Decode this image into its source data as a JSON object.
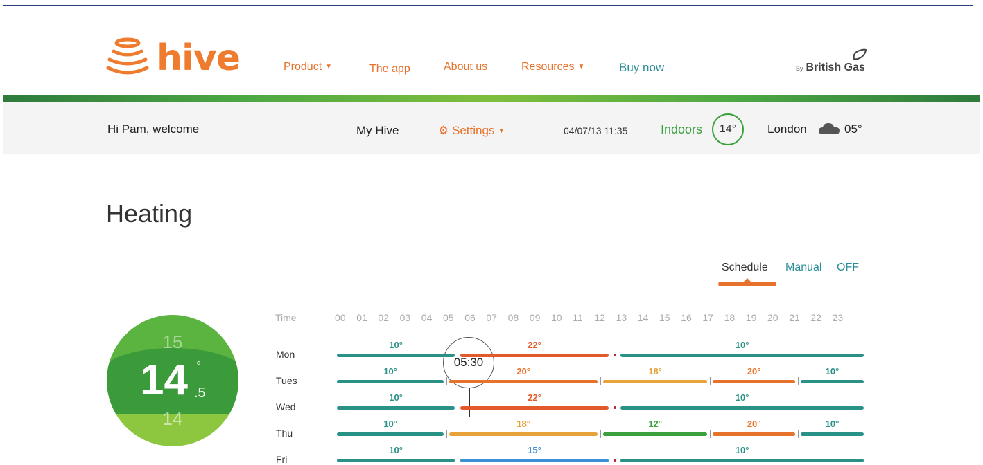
{
  "header": {
    "logo_text": "hive",
    "nav": [
      {
        "label": "Product",
        "dropdown": true
      },
      {
        "label": "The app",
        "dropdown": false
      },
      {
        "label": "About us",
        "dropdown": false
      },
      {
        "label": "Resources",
        "dropdown": true
      },
      {
        "label": "Buy now",
        "dropdown": false
      }
    ],
    "brand_by": "By",
    "brand_name": "British Gas"
  },
  "subbar": {
    "welcome": "Hi Pam, welcome",
    "my_hive": "My Hive",
    "settings": "Settings",
    "datetime": "04/07/13 11:35",
    "indoors_label": "Indoors",
    "indoors_temp": "14°",
    "city": "London",
    "outdoor_temp": "05°",
    "weather_icon": "cloud-icon"
  },
  "page": {
    "title": "Heating"
  },
  "mode_tabs": {
    "items": [
      "Schedule",
      "Manual",
      "OFF"
    ],
    "active": "Schedule"
  },
  "dial": {
    "upper": "15",
    "main": "14",
    "decimal": ".5",
    "degree": "°",
    "lower": "14"
  },
  "schedule": {
    "time_label": "Time",
    "hours": [
      "00",
      "01",
      "02",
      "03",
      "04",
      "05",
      "06",
      "07",
      "08",
      "09",
      "10",
      "11",
      "12",
      "13",
      "14",
      "15",
      "16",
      "17",
      "18",
      "19",
      "20",
      "21",
      "22",
      "23"
    ],
    "current_time_pin": "05:30",
    "days": [
      {
        "day": "Mon",
        "segments": [
          {
            "start": 0,
            "end": 5.5,
            "temp": "10°"
          },
          {
            "start": 5.5,
            "end": 12.5,
            "temp": "22°"
          },
          {
            "start": 12.8,
            "end": 24,
            "temp": "10°"
          }
        ]
      },
      {
        "day": "Tues",
        "segments": [
          {
            "start": 0,
            "end": 5,
            "temp": "10°"
          },
          {
            "start": 5,
            "end": 12,
            "temp": "20°"
          },
          {
            "start": 12,
            "end": 17,
            "temp": "18°"
          },
          {
            "start": 17,
            "end": 21,
            "temp": "20°"
          },
          {
            "start": 21,
            "end": 24,
            "temp": "10°"
          }
        ]
      },
      {
        "day": "Wed",
        "segments": [
          {
            "start": 0,
            "end": 5.5,
            "temp": "10°"
          },
          {
            "start": 5.5,
            "end": 12.5,
            "temp": "22°"
          },
          {
            "start": 12.8,
            "end": 24,
            "temp": "10°"
          }
        ]
      },
      {
        "day": "Thu",
        "segments": [
          {
            "start": 0,
            "end": 5,
            "temp": "10°"
          },
          {
            "start": 5,
            "end": 12,
            "temp": "18°"
          },
          {
            "start": 12,
            "end": 17,
            "temp": "12°"
          },
          {
            "start": 17,
            "end": 21,
            "temp": "20°"
          },
          {
            "start": 21,
            "end": 24,
            "temp": "10°"
          }
        ]
      },
      {
        "day": "Fri",
        "segments": [
          {
            "start": 0,
            "end": 5.5,
            "temp": "10°"
          },
          {
            "start": 5.5,
            "end": 12.5,
            "temp": "15°"
          },
          {
            "start": 12.8,
            "end": 24,
            "temp": "10°"
          }
        ]
      }
    ]
  },
  "colors": {
    "orange": "#e7722b",
    "teal": "#2a9187",
    "red_orange": "#e25a2a",
    "amber": "#e8a23a",
    "green": "#3aa13c",
    "blue": "#3b8fd6"
  }
}
